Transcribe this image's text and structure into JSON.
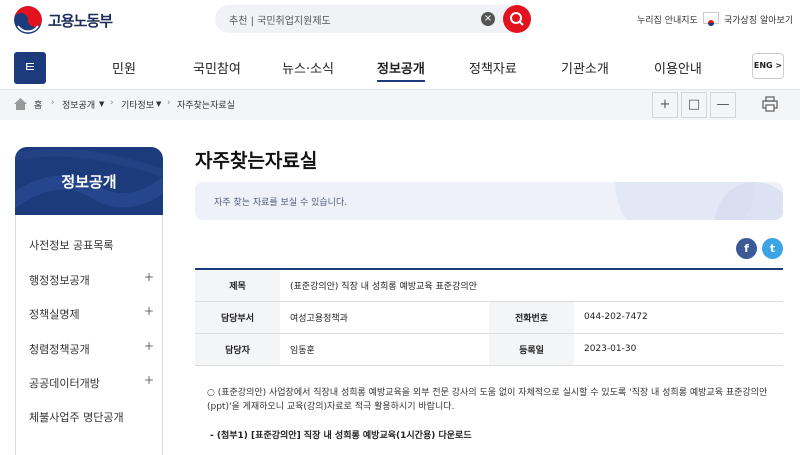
{
  "header": {
    "logo_text": "고용노동부",
    "search_value": "추천 | 국민취업지원제도",
    "links": [
      "누리집 안내지도",
      "국가상징 알아보기"
    ]
  },
  "nav": {
    "menu_icon": "ㅌ",
    "items": [
      "민원",
      "국민참여",
      "뉴스·소식",
      "정보공개",
      "정책자료",
      "기관소개",
      "이용안내"
    ],
    "active": "정보공개",
    "lang": "ENG >"
  },
  "breadcrumb": {
    "home": "홈",
    "items": [
      "정보공개",
      "기타정보",
      "자주찾는자료실"
    ],
    "tools": [
      "+",
      "□",
      "—"
    ]
  },
  "sidebar": {
    "title": "정보공개",
    "items": [
      "사전정보 공표목록",
      "행정정보공개",
      "정책실명제",
      "청렴정책공개",
      "공공데이터개방",
      "체불사업주 명단공개"
    ]
  },
  "main": {
    "title": "자주찾는자료실",
    "info": "자주 찾는 자료를 보실 수 있습니다.",
    "sns": {
      "facebook": "f",
      "twitter": "t"
    },
    "table": {
      "subject_label": "제목",
      "subject": "(표준강의안) 직장 내 성희롱 예방교육 표준강의안",
      "dept_label": "담당부서",
      "dept": "여성고용정책과",
      "phone_label": "전화번호",
      "phone": "044-202-7472",
      "person_label": "담당자",
      "person": "임동훈",
      "date_label": "등록일",
      "date": "2023-01-30"
    },
    "body": "○ (표준강의안) 사업장에서 직장내 성희롱 예방교육을 외부 전문 강사의 도움 없이 자체적으로 실시할 수 있도록 '직장 내 성희롱 예방교육 표준강의안(ppt)'을 게재하오니 교육(강의)자료로 적극 활용하시기 바랍니다.",
    "download": "- (첨부1) [표준강의안] 직장 내 성희롱 예방교육(1시간용) 다운로드"
  },
  "colors": {
    "brand": "#1c3b7d",
    "accent": "#e2131f"
  }
}
